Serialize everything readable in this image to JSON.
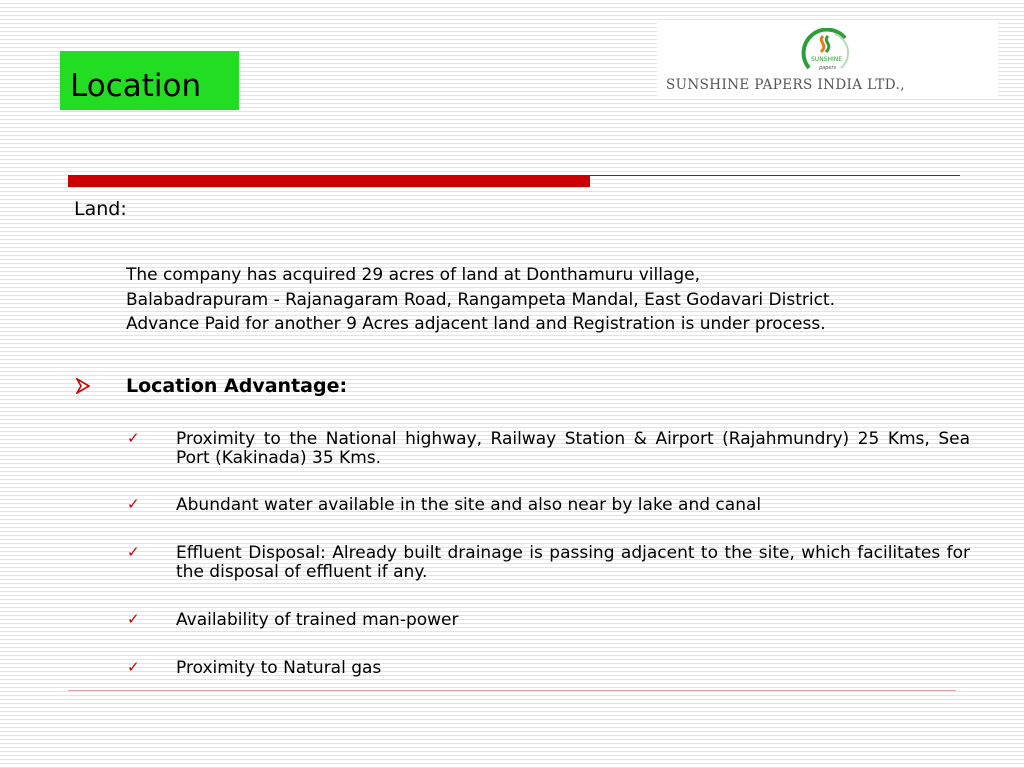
{
  "slide": {
    "title": "Location"
  },
  "logo": {
    "mark_text_1": "SUNSHINE",
    "mark_text_2": "papers",
    "company_name": "SUNSHINE PAPERS INDIA LTD.,"
  },
  "land": {
    "label": "Land:",
    "lines": [
      "The company has acquired  29 acres of land at Donthamuru village,",
      "Balabadrapuram - Rajanagaram Road, Rangampeta Mandal, East Godavari District.",
      "Advance Paid for another 9 Acres adjacent land  and Registration is under  process."
    ]
  },
  "advantage": {
    "heading": "Location Advantage:",
    "items": [
      "Proximity to the National highway, Railway Station & Airport (Rajahmundry) 25 Kms, Sea Port (Kakinada) 35 Kms.",
      "Abundant water available in the site and also near by lake and canal",
      "Effluent Disposal: Already built drainage is passing adjacent to the site, which facilitates for the disposal of effluent if any.",
      "Availability of trained man-power",
      "Proximity to Natural gas"
    ]
  },
  "colors": {
    "title_bg": "#22dd22",
    "accent_red": "#cc0000",
    "logo_green": "#2e9e3a",
    "logo_orange": "#e87a1e"
  },
  "icons": {
    "bullet": "arrow-bullet-icon",
    "item_bullet": "checkmark-icon"
  }
}
